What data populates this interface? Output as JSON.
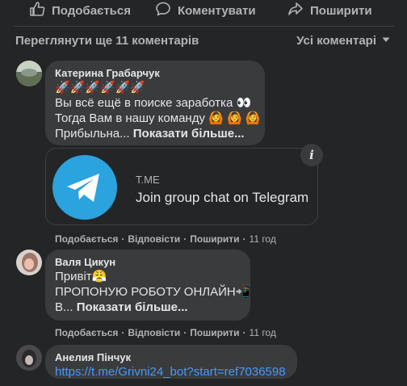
{
  "actions": {
    "like": "Подобається",
    "comment": "Коментувати",
    "share": "Поширити"
  },
  "comments_header": {
    "view_more": "Переглянути ще 11 коментарів",
    "filter": "Усі коментарі"
  },
  "comments": [
    {
      "author": "Катерина Грабарчук",
      "lines": [
        "🚀🚀🚀🚀🚀🚀",
        "Вы всё ещё в поиске заработка 👀",
        "Тогда Вам в нашу команду 🙆 🙆 🙆",
        "Прибыльна... "
      ],
      "see_more": "Показати більше...",
      "link_card": {
        "domain": "T.ME",
        "title": "Join group chat on Telegram"
      },
      "meta": {
        "like": "Подобається",
        "reply": "Відповісти",
        "share": "Поширити",
        "time": "11 год"
      }
    },
    {
      "author": "Валя Цикун",
      "lines": [
        "Привіт😤",
        "ПРОПОНУЮ РОБОТУ ОНЛАЙН📲",
        "В... "
      ],
      "see_more": "Показати більше...",
      "meta": {
        "like": "Подобається",
        "reply": "Відповісти",
        "share": "Поширити",
        "time": "11 год"
      }
    },
    {
      "author": "Анелия Пінчук",
      "link": "https://t.me/Grivni24_bot?start=ref7036598"
    }
  ],
  "colors": {
    "background": "#242526",
    "bubble": "#3a3b3c",
    "link": "#4599ff",
    "telegram": "#2aa3de"
  },
  "icons": [
    "like-icon",
    "comment-icon",
    "share-icon",
    "chevron-down-icon",
    "info-icon",
    "telegram-logo-icon"
  ]
}
